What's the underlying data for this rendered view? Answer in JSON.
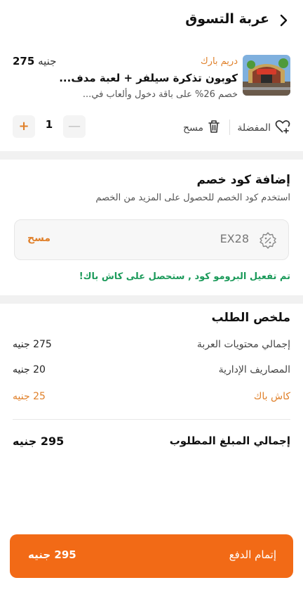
{
  "header": {
    "title": "عربة التسوق",
    "back_icon": "chevron-right-icon"
  },
  "item": {
    "brand": "دريم بارك",
    "title": "كوبون تذكرة سيلفر + لعبة  مدف...",
    "description": "خصم 26% على باقة دخول وألعاب في...",
    "price_number": "275",
    "price_currency": "جنيه",
    "thumbnail_icon": "park-entrance-image",
    "favorite_label": "المفضلة",
    "delete_label": "مسح",
    "quantity": "1",
    "plus": "+",
    "minus": "—"
  },
  "coupon": {
    "title": "إضافة كود خصم",
    "subtitle": "استخدم كود الخصم للحصول على المزيد من الخصم",
    "code": "EX28",
    "clear_label": "مسح",
    "tag_icon": "coupon-tag-icon",
    "success_message": "تم تفعيل البرومو كود ,  ستحصل على كاش باك!"
  },
  "summary": {
    "title": "ملخص الطلب",
    "rows": [
      {
        "label": "إجمالي محتويات العربة",
        "value": "275 جنيه"
      },
      {
        "label": "المصاريف الإدارية",
        "value": "20 جنيه"
      },
      {
        "label": "كاش باك",
        "value": "25 جنيه"
      }
    ],
    "total_label": "إجمالي المبلغ المطلوب",
    "total_value": "295 جنيه"
  },
  "checkout": {
    "label": "إتمام الدفع",
    "amount": "295 جنيه"
  },
  "colors": {
    "accent": "#f26a16",
    "brand_text": "#e0802a",
    "success": "#1b9a5a"
  }
}
